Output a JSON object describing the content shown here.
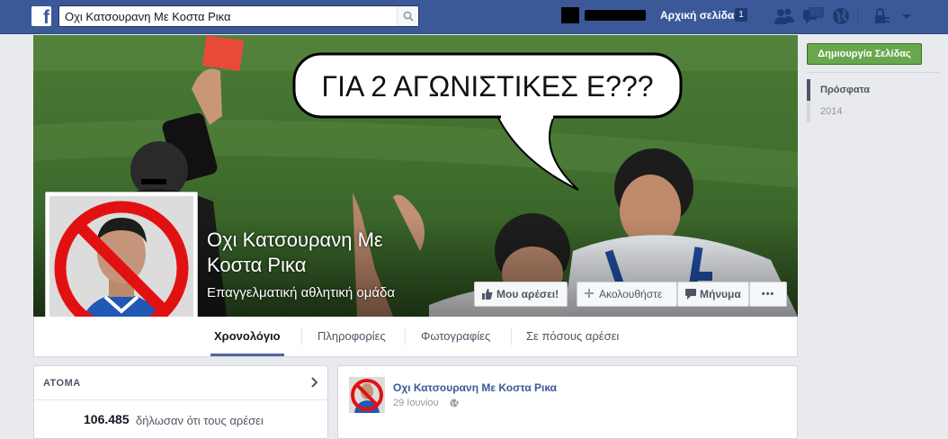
{
  "topbar": {
    "search_value": "Οχι Κατσουρανη Με Κοστα Ρικα",
    "home_label": "Αρχική σελίδα",
    "home_count": "1",
    "icons": [
      "friend-requests-icon",
      "messages-icon",
      "notifications-globe-icon",
      "privacy-shortcuts-icon",
      "account-settings-icon"
    ]
  },
  "cover": {
    "bubble_text": "ΓΙΑ 2 ΑΓΩΝΙΣΤΙΚΕΣ Ε???"
  },
  "page": {
    "name": "Οχι Κατσουρανη Με Κοστα Ρικα",
    "category": "Επαγγελματική αθλητική ομάδα"
  },
  "actions": {
    "like": "Μου αρέσει!",
    "follow": "Ακολουθήστε",
    "message": "Μήνυμα",
    "more": "•••"
  },
  "tabs": [
    "Χρονολόγιο",
    "Πληροφορίες",
    "Φωτογραφίες",
    "Σε πόσους αρέσει"
  ],
  "people_card": {
    "title": "ΑΤΟΜΑ",
    "likes_count": "106.485",
    "likes_text": "δήλωσαν ότι τους αρέσει"
  },
  "post": {
    "author": "Οχι Κατσουρανη Με Κοστα Ρικα",
    "date": "29 Ιουνίου"
  },
  "sidebar": {
    "create_page": "Δημιουργία Σελίδας",
    "timeline_items": [
      {
        "label": "Πρόσφατα",
        "active": true
      },
      {
        "label": "2014",
        "active": false
      }
    ]
  },
  "colors": {
    "topbar": "#3b5998",
    "link": "#3b5998",
    "create_button": "#69a74e",
    "background": "#e9eaed"
  }
}
